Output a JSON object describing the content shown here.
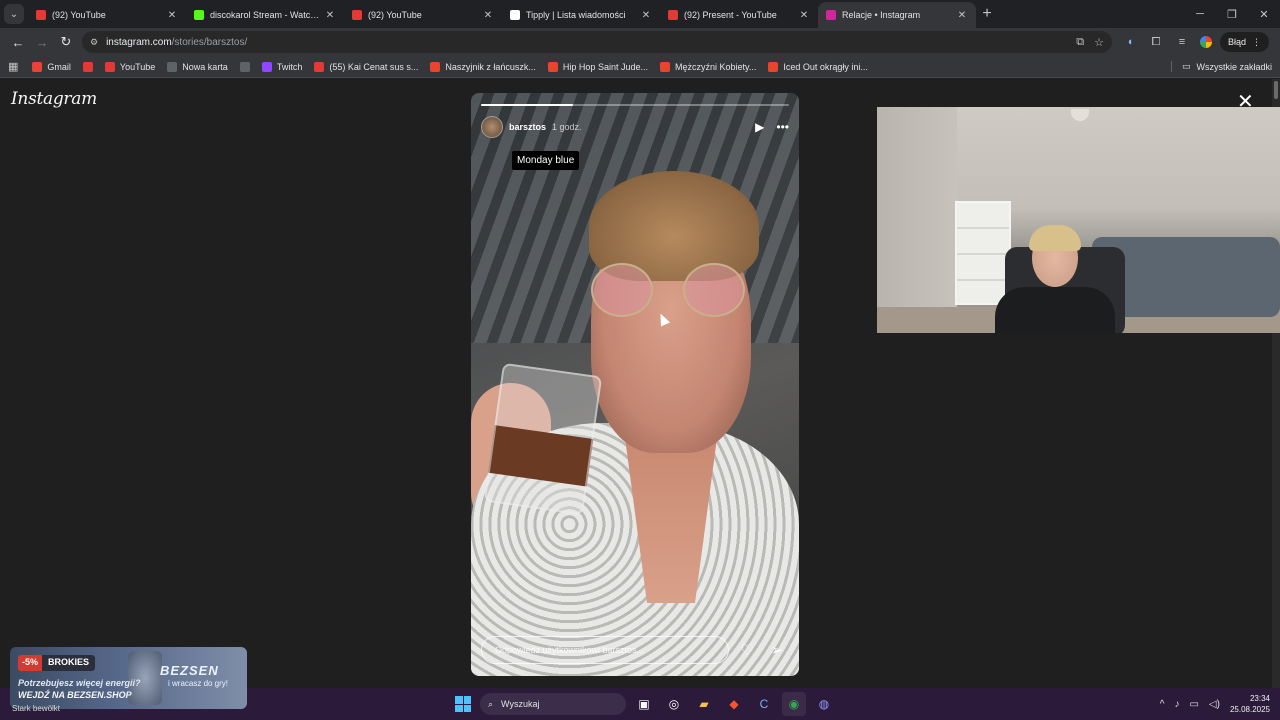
{
  "browser": {
    "tabs": [
      {
        "title": "(92) YouTube",
        "icon": "youtube-icon",
        "color": "#e53935",
        "active": false
      },
      {
        "title": "discokarol Stream - Watch Live",
        "icon": "kick-icon",
        "color": "#53fc18",
        "active": false
      },
      {
        "title": "(92) YouTube",
        "icon": "youtube-icon",
        "color": "#e53935",
        "active": false
      },
      {
        "title": "Tipply | Lista wiadomości",
        "icon": "tipply-icon",
        "color": "#ffffff",
        "active": false
      },
      {
        "title": "(92) Present - YouTube",
        "icon": "youtube-icon",
        "color": "#e53935",
        "active": false
      },
      {
        "title": "Relacje • Instagram",
        "icon": "instagram-icon",
        "color": "#d6249f",
        "active": true
      }
    ],
    "address": {
      "host": "instagram.com",
      "path": "/stories/barsztos/"
    },
    "profile_status": "Błąd",
    "bookmarks": [
      {
        "label": "Gmail",
        "icon": "gmail-icon"
      },
      {
        "label": "",
        "icon": "youtube-icon"
      },
      {
        "label": "YouTube",
        "icon": "youtube-icon"
      },
      {
        "label": "Nowa karta",
        "icon": "chrome-icon"
      },
      {
        "label": "",
        "icon": "globe-icon"
      },
      {
        "label": "Twitch",
        "icon": "twitch-icon"
      },
      {
        "label": "(55) Kai Cenat sus s...",
        "icon": "youtube-icon"
      },
      {
        "label": "Naszyjnik z łańcuszk...",
        "icon": "shop-icon"
      },
      {
        "label": "Hip Hop Saint Jude...",
        "icon": "shop-icon"
      },
      {
        "label": "Mężczyźni Kobiety...",
        "icon": "shop-icon"
      },
      {
        "label": "Iced Out okrągły ini...",
        "icon": "shop-icon"
      }
    ],
    "all_bookmarks": "Wszystkie zakładki"
  },
  "instagram": {
    "logo": "Instagram",
    "story": {
      "username": "barsztos",
      "time": "1 godz.",
      "sticker": "Monday blue",
      "progress": 0.3,
      "reply_placeholder": "Odpowiedz użytkownikowi barsztos..."
    }
  },
  "promo": {
    "discount": "-5%",
    "brand": "BROKIES",
    "logo": "BEZSEN",
    "logo_sub": "i wracasz do gry!",
    "line1": "Potrzebujesz więcej energii?",
    "line2": "WEJDŹ NA BEZSEN.SHOP"
  },
  "taskbar": {
    "weather": "Stark bewölkt",
    "search_placeholder": "Wyszukaj",
    "time": "23:34",
    "date": "25.08.2025",
    "accent": "#4cc2ff"
  }
}
